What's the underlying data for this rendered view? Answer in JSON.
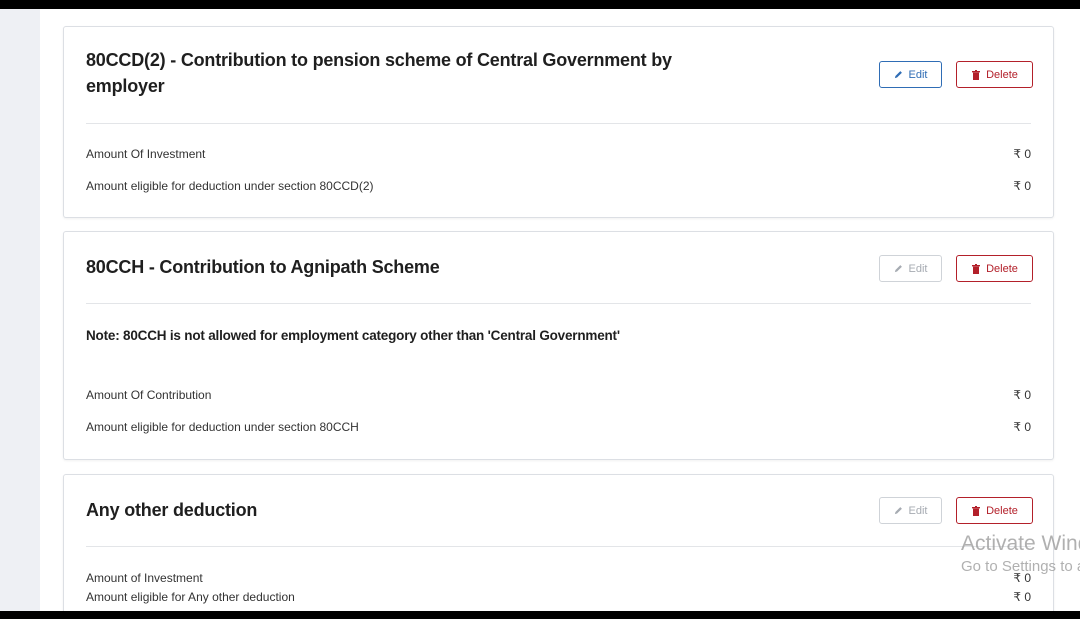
{
  "cards": [
    {
      "title": "80CCD(2) - Contribution to pension scheme of Central Government by employer",
      "edit_label": "Edit",
      "delete_label": "Delete",
      "rows": [
        {
          "label": "Amount Of Investment",
          "value": "₹ 0"
        },
        {
          "label": "Amount eligible for deduction under section 80CCD(2)",
          "value": "₹ 0"
        }
      ]
    },
    {
      "title": "80CCH - Contribution to Agnipath Scheme",
      "edit_label": "Edit",
      "delete_label": "Delete",
      "note": "Note: 80CCH is not allowed for employment category other than 'Central Government'",
      "rows": [
        {
          "label": "Amount Of Contribution",
          "value": "₹ 0"
        },
        {
          "label": "Amount eligible for deduction under section 80CCH",
          "value": "₹ 0"
        }
      ]
    },
    {
      "title": "Any other deduction",
      "edit_label": "Edit",
      "delete_label": "Delete",
      "rows": [
        {
          "label": "Amount of Investment",
          "value": "₹ 0"
        },
        {
          "label": "Amount eligible for Any other deduction",
          "value": "₹ 0"
        }
      ]
    }
  ],
  "watermark": {
    "line1": "Activate Windows",
    "line2": "Go to Settings to activate Windows."
  },
  "colors": {
    "edit_active": "#2f6db5",
    "edit_disabled": "#a6abb2",
    "delete": "#b3202a"
  }
}
